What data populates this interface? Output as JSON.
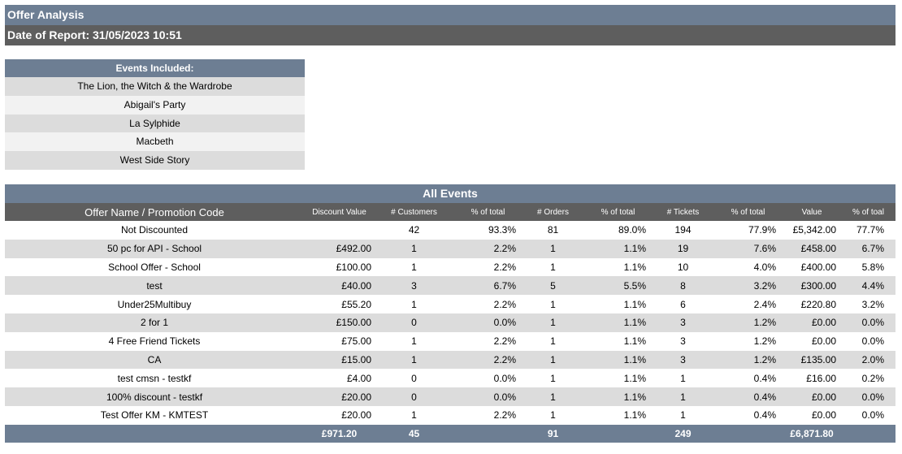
{
  "header": {
    "title": "Offer Analysis",
    "date_label": "Date of Report: 31/05/2023 10:51"
  },
  "events_included": {
    "heading": "Events Included:",
    "items": [
      "The Lion, the Witch & the Wardrobe",
      "Abigail's Party",
      "La Sylphide",
      "Macbeth",
      "West Side Story"
    ]
  },
  "offers_table": {
    "title": "All Events",
    "columns": [
      "Offer Name / Promotion Code",
      "Discount Value",
      "# Customers",
      "% of total",
      "# Orders",
      "% of total",
      "# Tickets",
      "% of total",
      "Value",
      "% of toal"
    ],
    "rows": [
      [
        "Not Discounted",
        "",
        "42",
        "93.3%",
        "81",
        "89.0%",
        "194",
        "77.9%",
        "£5,342.00",
        "77.7%"
      ],
      [
        "50 pc for API - School",
        "£492.00",
        "1",
        "2.2%",
        "1",
        "1.1%",
        "19",
        "7.6%",
        "£458.00",
        "6.7%"
      ],
      [
        "School Offer - School",
        "£100.00",
        "1",
        "2.2%",
        "1",
        "1.1%",
        "10",
        "4.0%",
        "£400.00",
        "5.8%"
      ],
      [
        "test",
        "£40.00",
        "3",
        "6.7%",
        "5",
        "5.5%",
        "8",
        "3.2%",
        "£300.00",
        "4.4%"
      ],
      [
        "Under25Multibuy",
        "£55.20",
        "1",
        "2.2%",
        "1",
        "1.1%",
        "6",
        "2.4%",
        "£220.80",
        "3.2%"
      ],
      [
        "2 for 1",
        "£150.00",
        "0",
        "0.0%",
        "1",
        "1.1%",
        "3",
        "1.2%",
        "£0.00",
        "0.0%"
      ],
      [
        "4 Free Friend Tickets",
        "£75.00",
        "1",
        "2.2%",
        "1",
        "1.1%",
        "3",
        "1.2%",
        "£0.00",
        "0.0%"
      ],
      [
        "CA",
        "£15.00",
        "1",
        "2.2%",
        "1",
        "1.1%",
        "3",
        "1.2%",
        "£135.00",
        "2.0%"
      ],
      [
        "test cmsn - testkf",
        "£4.00",
        "0",
        "0.0%",
        "1",
        "1.1%",
        "1",
        "0.4%",
        "£16.00",
        "0.2%"
      ],
      [
        "100% discount - testkf",
        "£20.00",
        "0",
        "0.0%",
        "1",
        "1.1%",
        "1",
        "0.4%",
        "£0.00",
        "0.0%"
      ],
      [
        "Test Offer KM - KMTEST",
        "£20.00",
        "1",
        "2.2%",
        "1",
        "1.1%",
        "1",
        "0.4%",
        "£0.00",
        "0.0%"
      ]
    ],
    "totals": [
      "",
      "£971.20",
      "45",
      "",
      "91",
      "",
      "249",
      "",
      "£6,871.80",
      ""
    ]
  }
}
